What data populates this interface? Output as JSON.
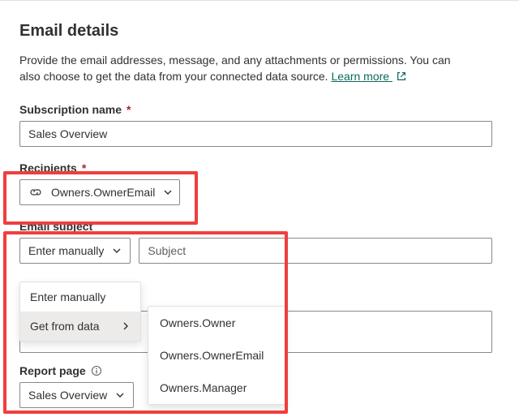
{
  "header": {
    "title": "Email details",
    "description_a": "Provide the email addresses, message, and any attachments or permissions. You can also choose to get the data from your connected data source. ",
    "learn_more": "Learn more"
  },
  "fields": {
    "subscription_name": {
      "label": "Subscription name",
      "value": "Sales Overview"
    },
    "recipients": {
      "label": "Recipients",
      "value": "Owners.OwnerEmail"
    },
    "email_subject": {
      "label": "Email subject",
      "mode_label": "Enter manually",
      "placeholder": "Subject",
      "menu": {
        "enter_manually": "Enter manually",
        "get_from_data": "Get from data",
        "data_options": [
          "Owners.Owner",
          "Owners.OwnerEmail",
          "Owners.Manager"
        ]
      }
    },
    "report_page": {
      "label": "Report page",
      "value": "Sales Overview"
    }
  }
}
